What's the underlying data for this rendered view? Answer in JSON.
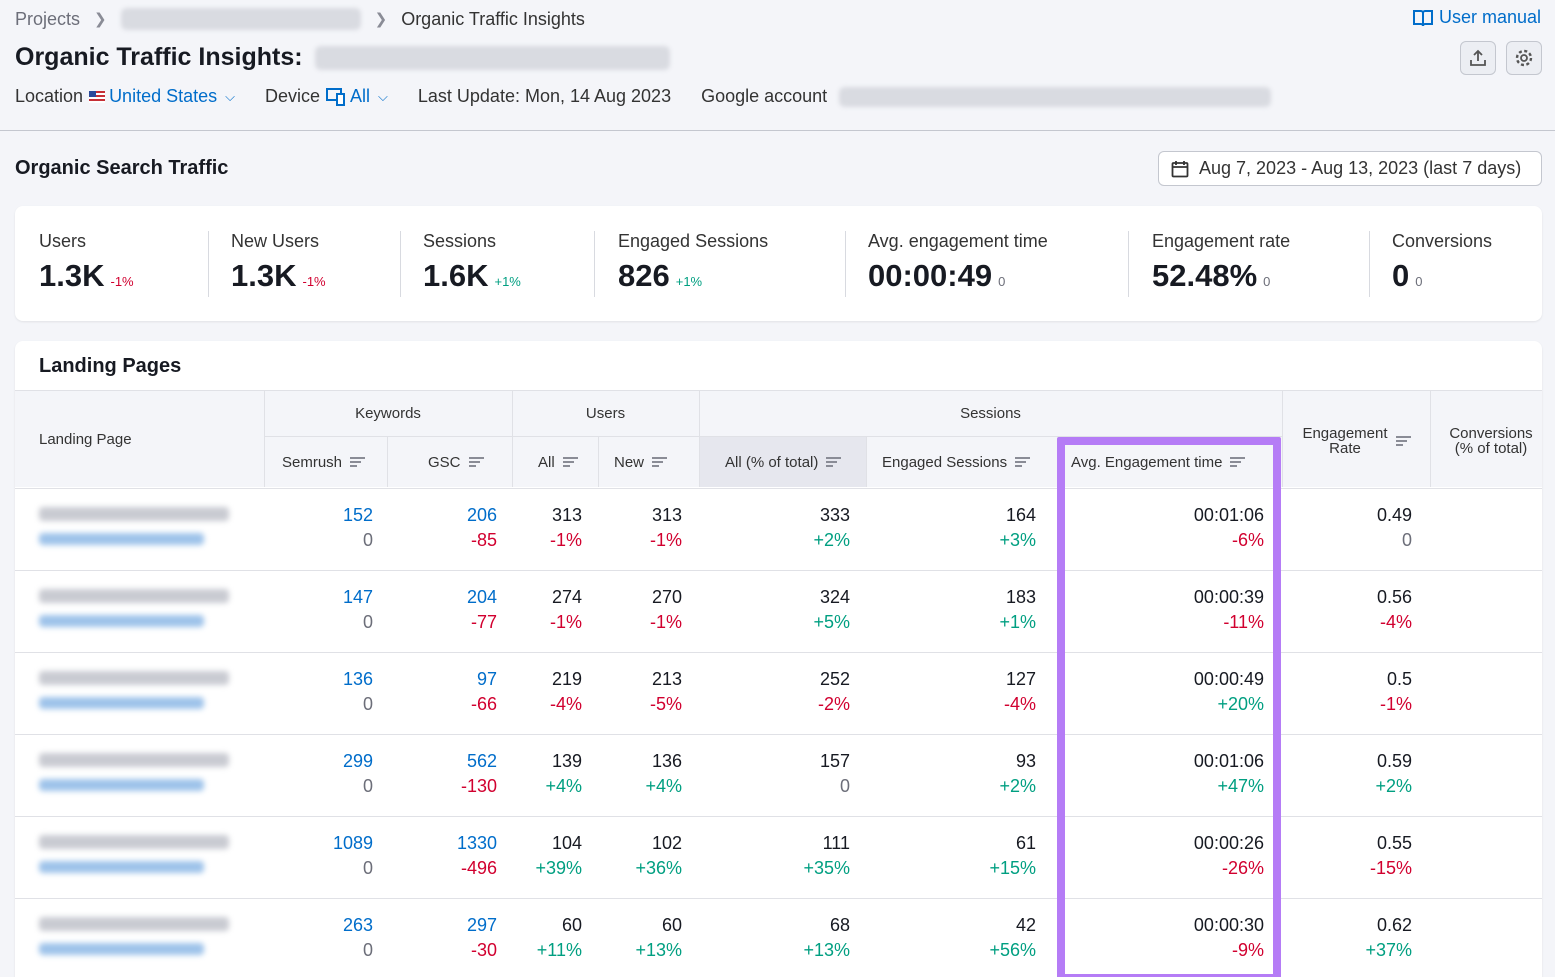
{
  "breadcrumb": {
    "root": "Projects",
    "current": "Organic Traffic Insights"
  },
  "user_manual": "User manual",
  "title": "Organic Traffic Insights:",
  "meta": {
    "location_label": "Location",
    "location_value": "United States",
    "device_label": "Device",
    "device_value": "All",
    "last_update": "Last Update: Mon, 14 Aug 2023",
    "google_account_label": "Google account"
  },
  "section_title": "Organic Search Traffic",
  "date_range": "Aug 7, 2023 - Aug 13, 2023 (last 7 days)",
  "kpis": [
    {
      "label": "Users",
      "value": "1.3K",
      "delta": "-1%",
      "tone": "neg"
    },
    {
      "label": "New Users",
      "value": "1.3K",
      "delta": "-1%",
      "tone": "neg"
    },
    {
      "label": "Sessions",
      "value": "1.6K",
      "delta": "+1%",
      "tone": "pos"
    },
    {
      "label": "Engaged Sessions",
      "value": "826",
      "delta": "+1%",
      "tone": "pos"
    },
    {
      "label": "Avg. engagement time",
      "value": "00:00:49",
      "delta": "0",
      "tone": "zero"
    },
    {
      "label": "Engagement rate",
      "value": "52.48%",
      "delta": "0",
      "tone": "zero"
    },
    {
      "label": "Conversions",
      "value": "0",
      "delta": "0",
      "tone": "zero"
    }
  ],
  "landing_pages": {
    "title": "Landing Pages",
    "groups": {
      "keywords": "Keywords",
      "users": "Users",
      "sessions": "Sessions"
    },
    "columns": {
      "landing_page": "Landing Page",
      "semrush": "Semrush",
      "gsc": "GSC",
      "users_all": "All",
      "users_new": "New",
      "sessions_all": "All (% of total)",
      "engaged_sessions": "Engaged Sessions",
      "avg_engagement_time": "Avg. Engagement time",
      "engagement_rate_1": "Engagement",
      "engagement_rate_2": "Rate",
      "conversions_1": "Conversions",
      "conversions_2": "(% of total)"
    },
    "rows": [
      {
        "semrush": "152",
        "semrush_d": "0",
        "gsc": "206",
        "gsc_d": "-85",
        "all": "313",
        "all_d": "-1%",
        "new": "313",
        "new_d": "-1%",
        "sess": "333",
        "sess_d": "+2%",
        "eng": "164",
        "eng_d": "+3%",
        "time": "00:01:06",
        "time_d": "-6%",
        "rate": "0.49",
        "rate_d": "0"
      },
      {
        "semrush": "147",
        "semrush_d": "0",
        "gsc": "204",
        "gsc_d": "-77",
        "all": "274",
        "all_d": "-1%",
        "new": "270",
        "new_d": "-1%",
        "sess": "324",
        "sess_d": "+5%",
        "eng": "183",
        "eng_d": "+1%",
        "time": "00:00:39",
        "time_d": "-11%",
        "rate": "0.56",
        "rate_d": "-4%"
      },
      {
        "semrush": "136",
        "semrush_d": "0",
        "gsc": "97",
        "gsc_d": "-66",
        "all": "219",
        "all_d": "-4%",
        "new": "213",
        "new_d": "-5%",
        "sess": "252",
        "sess_d": "-2%",
        "eng": "127",
        "eng_d": "-4%",
        "time": "00:00:49",
        "time_d": "+20%",
        "rate": "0.5",
        "rate_d": "-1%"
      },
      {
        "semrush": "299",
        "semrush_d": "0",
        "gsc": "562",
        "gsc_d": "-130",
        "all": "139",
        "all_d": "+4%",
        "new": "136",
        "new_d": "+4%",
        "sess": "157",
        "sess_d": "0",
        "eng": "93",
        "eng_d": "+2%",
        "time": "00:01:06",
        "time_d": "+47%",
        "rate": "0.59",
        "rate_d": "+2%"
      },
      {
        "semrush": "1089",
        "semrush_d": "0",
        "gsc": "1330",
        "gsc_d": "-496",
        "all": "104",
        "all_d": "+39%",
        "new": "102",
        "new_d": "+36%",
        "sess": "111",
        "sess_d": "+35%",
        "eng": "61",
        "eng_d": "+15%",
        "time": "00:00:26",
        "time_d": "-26%",
        "rate": "0.55",
        "rate_d": "-15%"
      },
      {
        "semrush": "263",
        "semrush_d": "0",
        "gsc": "297",
        "gsc_d": "-30",
        "all": "60",
        "all_d": "+11%",
        "new": "60",
        "new_d": "+13%",
        "sess": "68",
        "sess_d": "+13%",
        "eng": "42",
        "eng_d": "+56%",
        "time": "00:00:30",
        "time_d": "-9%",
        "rate": "0.62",
        "rate_d": "+37%"
      }
    ]
  },
  "colors": {
    "link": "#006dca",
    "negative": "#d1002f",
    "positive": "#009f81",
    "highlight": "#b57cf6"
  }
}
